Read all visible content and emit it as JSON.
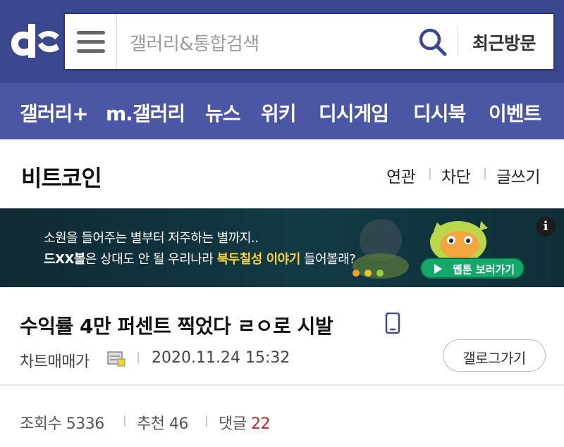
{
  "header": {
    "logo": "dc-logo",
    "search_placeholder": "갤러리&통합검색",
    "recent_label": "최근방문",
    "colors": {
      "bar": "#3b4890",
      "nav": "#4b57a5"
    }
  },
  "nav": {
    "items": [
      {
        "label": "갤러리+"
      },
      {
        "label": "m.갤러리"
      },
      {
        "label": "뉴스"
      },
      {
        "label": "위키"
      },
      {
        "label": "디시게임"
      },
      {
        "label": "디시북"
      },
      {
        "label": "이벤트"
      }
    ]
  },
  "gallery": {
    "title": "비트코인",
    "links": [
      {
        "label": "연관"
      },
      {
        "label": "차단"
      },
      {
        "label": "글쓰기"
      }
    ]
  },
  "banner": {
    "line1": "소원을 들어주는 별부터 저주하는 별까지..",
    "line2_part1": "드XX볼",
    "line2_part2": "은 상대도 안 될 우리나라 ",
    "line2_highlight": "북두칠성 이야기",
    "line2_part3": " 들어볼래?",
    "button_label": "웹툰 보러가기",
    "info_label": "i"
  },
  "post": {
    "title": "수익률 4만 퍼센트 찍었다 ㄹㅇ로 시발",
    "author": "차트매매가",
    "date": "2020.11.24 15:32",
    "gallery_button": "갤로그가기",
    "icons": {
      "device": "mobile-icon",
      "author_badge": "fixed-nick-icon"
    }
  },
  "stats": {
    "views_label": "조회수",
    "views": "5336",
    "recommend_label": "추천",
    "recommend": "46",
    "comments_label": "댓글",
    "comments": "22",
    "comment_color": "#c1272d"
  }
}
